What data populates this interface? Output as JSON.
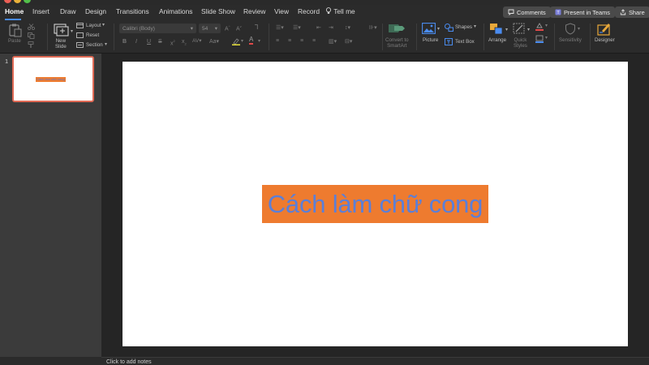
{
  "menu": {
    "tabs": [
      {
        "label": "Home",
        "active": true
      },
      {
        "label": "Insert"
      },
      {
        "label": "Draw"
      },
      {
        "label": "Design"
      },
      {
        "label": "Transitions"
      },
      {
        "label": "Animations"
      },
      {
        "label": "Slide Show"
      },
      {
        "label": "Review"
      },
      {
        "label": "View"
      },
      {
        "label": "Record"
      }
    ],
    "tell_me": "Tell me",
    "comments_label": "Comments",
    "present_teams_label": "Present in Teams",
    "share_label": "Share"
  },
  "ribbon": {
    "paste": "Paste",
    "new_slide": "New\nSlide",
    "layout": "Layout",
    "reset": "Reset",
    "section": "Section",
    "font_name": "Calibri (Body)",
    "font_size": "54",
    "convert_smartart": "Convert to\nSmartArt",
    "picture": "Picture",
    "shapes": "Shapes",
    "text_box": "Text Box",
    "arrange": "Arrange",
    "quick_styles": "Quick\nStyles",
    "sensitivity": "Sensitivity",
    "designer": "Designer"
  },
  "thumbnails": [
    {
      "number": "1",
      "title": "Cách làm chữ cong"
    }
  ],
  "slide": {
    "title": "Cách làm chữ cong",
    "box_color": "#ee7b2f",
    "text_color": "#5b7fd8"
  },
  "notes": {
    "placeholder": "Click to add notes"
  },
  "colors": {
    "accent": "#4a8cf0",
    "selection_border": "#e06a55"
  }
}
